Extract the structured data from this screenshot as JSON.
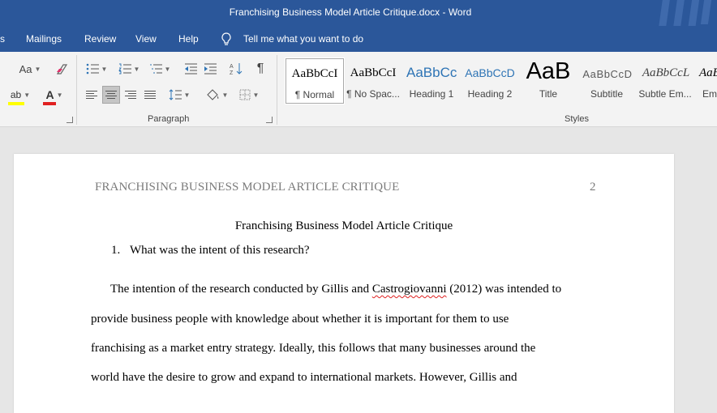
{
  "window": {
    "title": "Franchising Business Model Article Critique.docx  -  Word"
  },
  "menu": {
    "items": [
      "s",
      "Mailings",
      "Review",
      "View",
      "Help"
    ],
    "tell_me": "Tell me what you want to do"
  },
  "ribbon": {
    "font": {
      "case_label": "Aa",
      "highlight_glyph": "ab",
      "font_color_glyph": "A"
    },
    "paragraph": {
      "label": "Paragraph",
      "pilcrow": "¶"
    },
    "styles": {
      "label": "Styles",
      "items": [
        {
          "sample": "AaBbCcI",
          "name": "¶ Normal"
        },
        {
          "sample": "AaBbCcI",
          "name": "¶ No Spac..."
        },
        {
          "sample": "AaBbCc",
          "name": "Heading 1"
        },
        {
          "sample": "AaBbCcD",
          "name": "Heading 2"
        },
        {
          "sample": "AaB",
          "name": "Title"
        },
        {
          "sample": "AaBbCcD",
          "name": "Subtitle"
        },
        {
          "sample": "AaBbCcL",
          "name": "Subtle Em..."
        },
        {
          "sample": "AaBl",
          "name": "Em"
        }
      ]
    }
  },
  "document": {
    "running_header": "FRANCHISING BUSINESS MODEL ARTICLE CRITIQUE",
    "page_number": "2",
    "title": "Franchising Business Model Article Critique",
    "question_number": "1.",
    "question_text": "What was the intent of this research?",
    "para": {
      "l1_pre": "The intention of the research conducted by Gillis and ",
      "l1_misspelled": "Castrogiovanni",
      "l1_post": " (2012) was intended to",
      "l2": "provide business people with knowledge about whether it is important for them to use",
      "l3": "franchising as a market entry strategy. Ideally, this follows that many businesses around the",
      "l4": "world have the desire to grow and expand to international markets. However, Gillis and"
    }
  },
  "colors": {
    "title_bar": "#2b579a",
    "ribbon": "#f3f3f3",
    "canvas": "#e6e6e6",
    "heading_blue": "#2e74b5",
    "font_color_red": "#e02020",
    "highlight_yellow": "#ffff00"
  }
}
